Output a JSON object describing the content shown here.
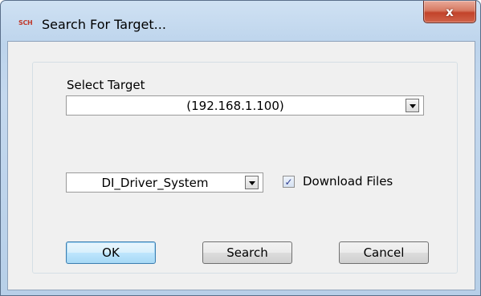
{
  "window": {
    "title": "Search For Target...",
    "app_icon_text": "SCH",
    "close_glyph": "x"
  },
  "form": {
    "select_target_label": "Select Target",
    "target_value": "(192.168.1.100)",
    "system_value": "DI_Driver_System",
    "download_files_label": "Download Files",
    "download_files_checked": true,
    "checkmark_glyph": "✓"
  },
  "buttons": {
    "ok_label": "OK",
    "search_label": "Search",
    "cancel_label": "Cancel"
  },
  "colors": {
    "close_button": "#c2432a",
    "default_button_border": "#3c7fb1",
    "title_bar": "#bdd4ec"
  },
  "icons": {
    "app": "app-icon",
    "close": "close-icon",
    "dropdown": "chevron-down-icon",
    "check": "check-icon"
  }
}
